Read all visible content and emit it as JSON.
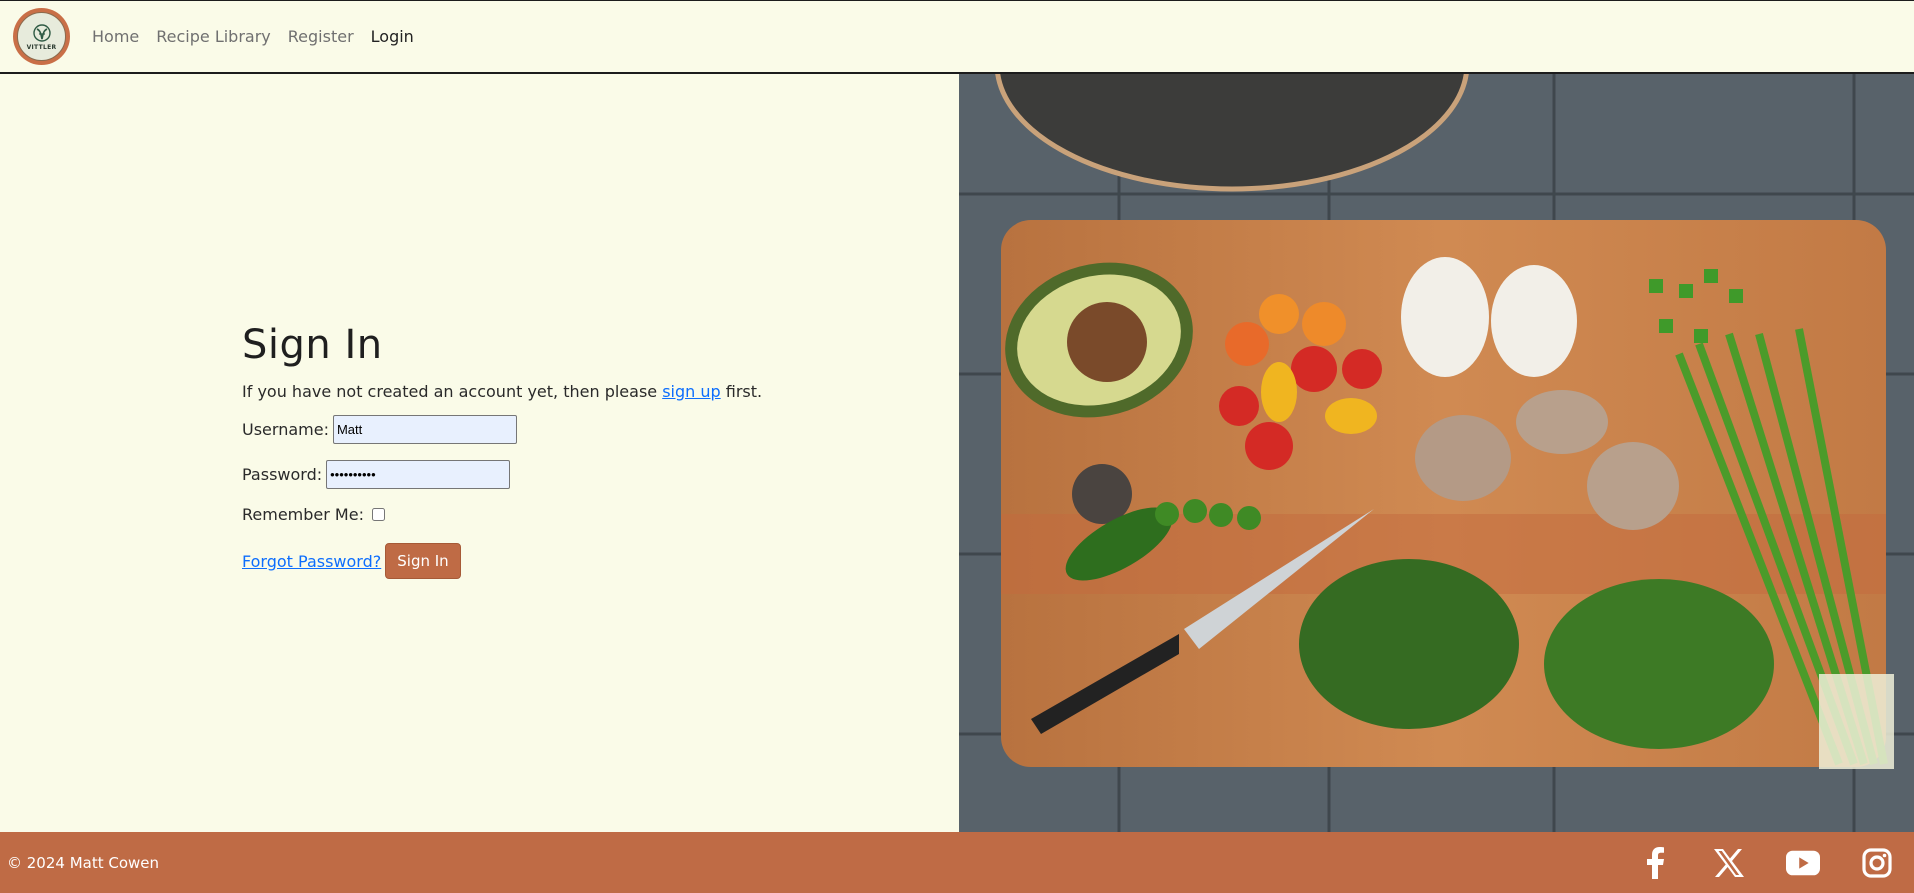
{
  "brand": {
    "logo_text": "VITTLER"
  },
  "nav": {
    "items": [
      {
        "label": "Home"
      },
      {
        "label": "Recipe Library"
      },
      {
        "label": "Register"
      },
      {
        "label": "Login",
        "active": true
      }
    ]
  },
  "signin": {
    "title": "Sign In",
    "intro_before": "If you have not created an account yet, then please ",
    "intro_link": "sign up",
    "intro_after": " first.",
    "username_label": "Username:",
    "username_value": "Matt",
    "password_label": "Password:",
    "password_value": "••••••••••",
    "remember_label": "Remember Me:",
    "forgot_label": "Forgot Password?",
    "submit_label": "Sign In"
  },
  "footer": {
    "copyright": "© 2024 Matt Cowen",
    "socials": [
      "facebook-icon",
      "x-icon",
      "youtube-icon",
      "instagram-icon"
    ]
  },
  "colors": {
    "background": "#fafbe8",
    "accent": "#bf6b45",
    "link": "#0d6efd"
  }
}
